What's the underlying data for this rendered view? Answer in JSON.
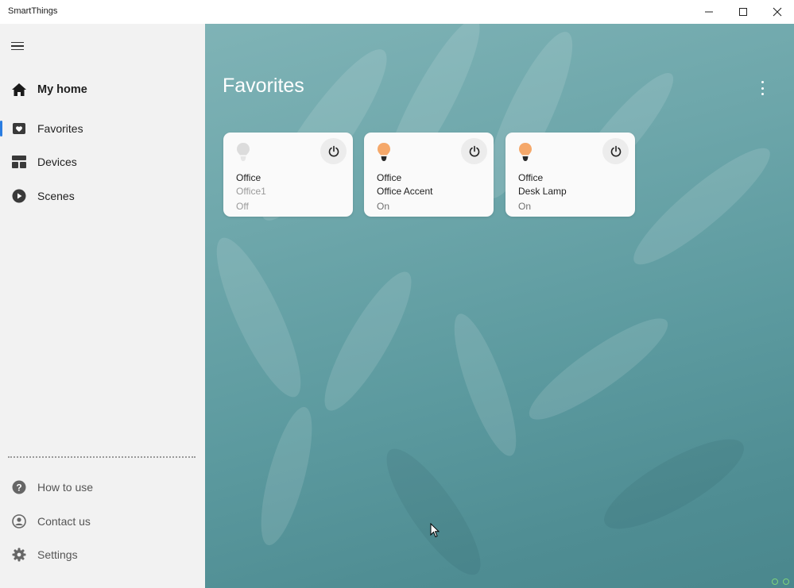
{
  "window": {
    "title": "SmartThings"
  },
  "sidebar": {
    "home_label": "My home",
    "items": [
      {
        "label": "Favorites",
        "icon": "heart-icon",
        "active": true
      },
      {
        "label": "Devices",
        "icon": "grid-icon",
        "active": false
      },
      {
        "label": "Scenes",
        "icon": "play-icon",
        "active": false
      }
    ],
    "bottom_items": [
      {
        "label": "How to use",
        "icon": "help-icon"
      },
      {
        "label": "Contact us",
        "icon": "contact-icon"
      },
      {
        "label": "Settings",
        "icon": "gear-icon"
      }
    ]
  },
  "main": {
    "title": "Favorites",
    "cards": [
      {
        "room": "Office",
        "device": "Office1",
        "state": "Off",
        "bulb_color": "#d9d9d9"
      },
      {
        "room": "Office",
        "device": "Office Accent",
        "state": "On",
        "bulb_color": "#f5a86a"
      },
      {
        "room": "Office",
        "device": "Desk Lamp",
        "state": "On",
        "bulb_color": "#f5a86a"
      }
    ]
  },
  "colors": {
    "accent": "#2a7de1",
    "bulb_on": "#f5a86a",
    "bulb_off": "#d9d9d9",
    "background": "#6ea7ab"
  }
}
